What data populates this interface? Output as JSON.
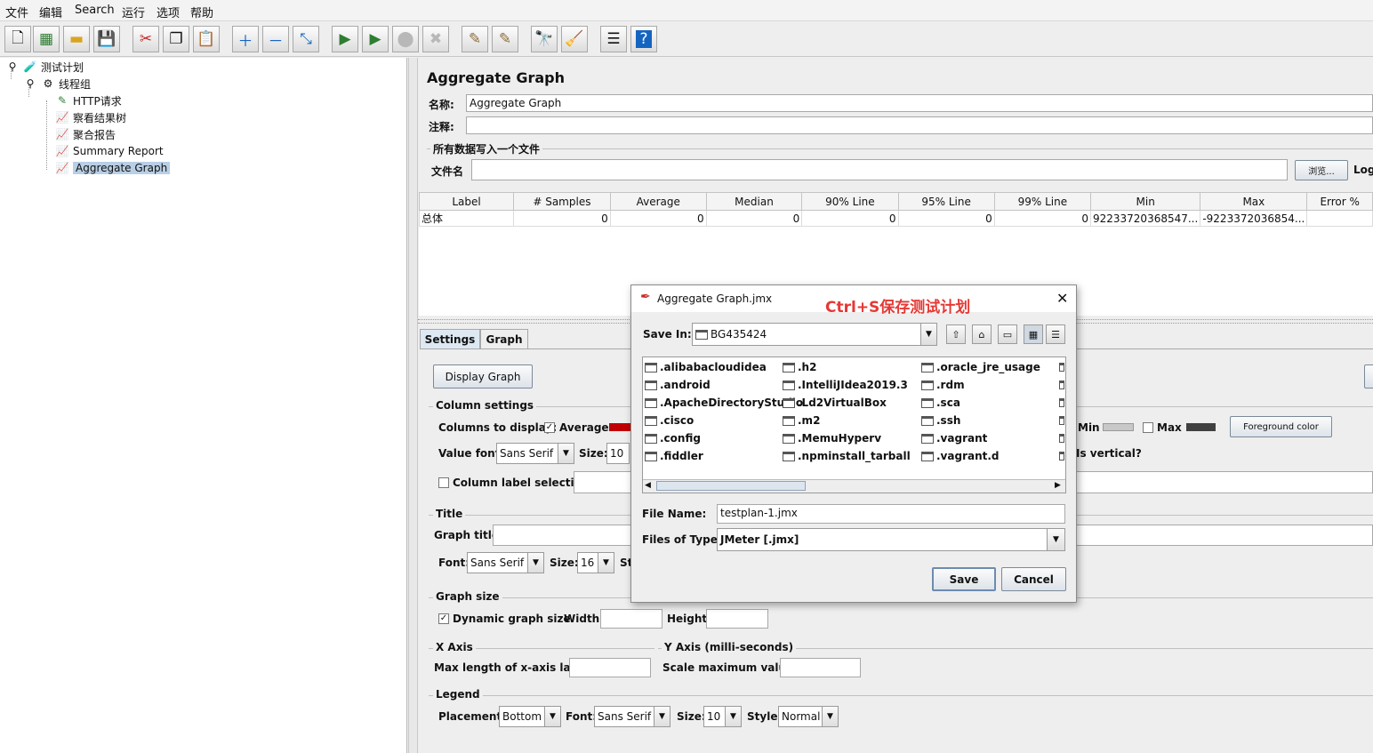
{
  "menu": [
    "文件",
    "编辑",
    "Search",
    "运行",
    "选项",
    "帮助"
  ],
  "tree": {
    "items": [
      {
        "label": "测试计划"
      },
      {
        "label": "线程组"
      },
      {
        "label": "HTTP请求"
      },
      {
        "label": "察看结果树"
      },
      {
        "label": "聚合报告"
      },
      {
        "label": "Summary Report"
      },
      {
        "label": "Aggregate Graph"
      }
    ]
  },
  "panel": {
    "title": "Aggregate Graph",
    "name_label": "名称:",
    "name_value": "Aggregate Graph",
    "comment_label": "注释:",
    "write_all_label": "所有数据写入一个文件",
    "filename_label": "文件名",
    "browse_label": "浏览...",
    "log_label": "Log"
  },
  "table": {
    "headers": [
      "Label",
      "# Samples",
      "Average",
      "Median",
      "90% Line",
      "95% Line",
      "99% Line",
      "Min",
      "Max",
      "Error %"
    ],
    "rows": [
      [
        "总体",
        "0",
        "0",
        "0",
        "0",
        "0",
        "0",
        "92233720368547...",
        "-9223372036854...",
        ""
      ]
    ]
  },
  "tabs": {
    "settings": "Settings",
    "graph": "Graph"
  },
  "settings": {
    "display_graph": "Display Graph",
    "column_settings": "Column settings",
    "columns_to_display": "Columns to display:",
    "average_label": "Average",
    "min_label": "Min",
    "max_label": "Max",
    "foreground_color": "Foreground color",
    "value_font_label": "Value font:",
    "value_font": "Sans Serif",
    "size_label": "Size:",
    "value_size": "10",
    "is_vertical": "Is vertical?",
    "column_label_selection": "Column label selection:",
    "title_group": "Title",
    "graph_title": "Graph title:",
    "font_label": "Font:",
    "title_font": "Sans Serif",
    "title_size": "16",
    "style_label_cut": "St",
    "graph_size": "Graph size",
    "dynamic_graph_size": "Dynamic graph size",
    "width_label": "Width:",
    "height_label": "Height:",
    "x_axis": "X Axis",
    "max_length_label": "Max length of x-axis label:",
    "y_axis": "Y Axis (milli-seconds)",
    "scale_max": "Scale maximum value:",
    "legend": "Legend",
    "placement_label": "Placement:",
    "placement": "Bottom",
    "legend_font": "Sans Serif",
    "legend_size": "10",
    "style_label": "Style:",
    "style": "Normal"
  },
  "dialog": {
    "title": "Aggregate Graph.jmx",
    "annotation": "Ctrl+S保存测试计划",
    "save_in_label": "Save In:",
    "save_in": "BG435424",
    "files": [
      ".alibabacloudidea",
      ".android",
      ".ApacheDirectoryStudio",
      ".cisco",
      ".config",
      ".fiddler",
      ".h2",
      ".IntelliJIdea2019.3",
      ".Ld2VirtualBox",
      ".m2",
      ".MemuHyperv",
      ".npminstall_tarball",
      ".oracle_jre_usage",
      ".rdm",
      ".sca",
      ".ssh",
      ".vagrant",
      ".vagrant.d"
    ],
    "file_name_label": "File Name:",
    "file_name": "testplan-1.jmx",
    "files_of_type_label": "Files of Type:",
    "files_of_type": "JMeter [.jmx]",
    "save": "Save",
    "cancel": "Cancel"
  },
  "colors": {
    "annotation": "#e53935",
    "average_swatch": "#c00000",
    "selection": "#b8cfe5"
  }
}
